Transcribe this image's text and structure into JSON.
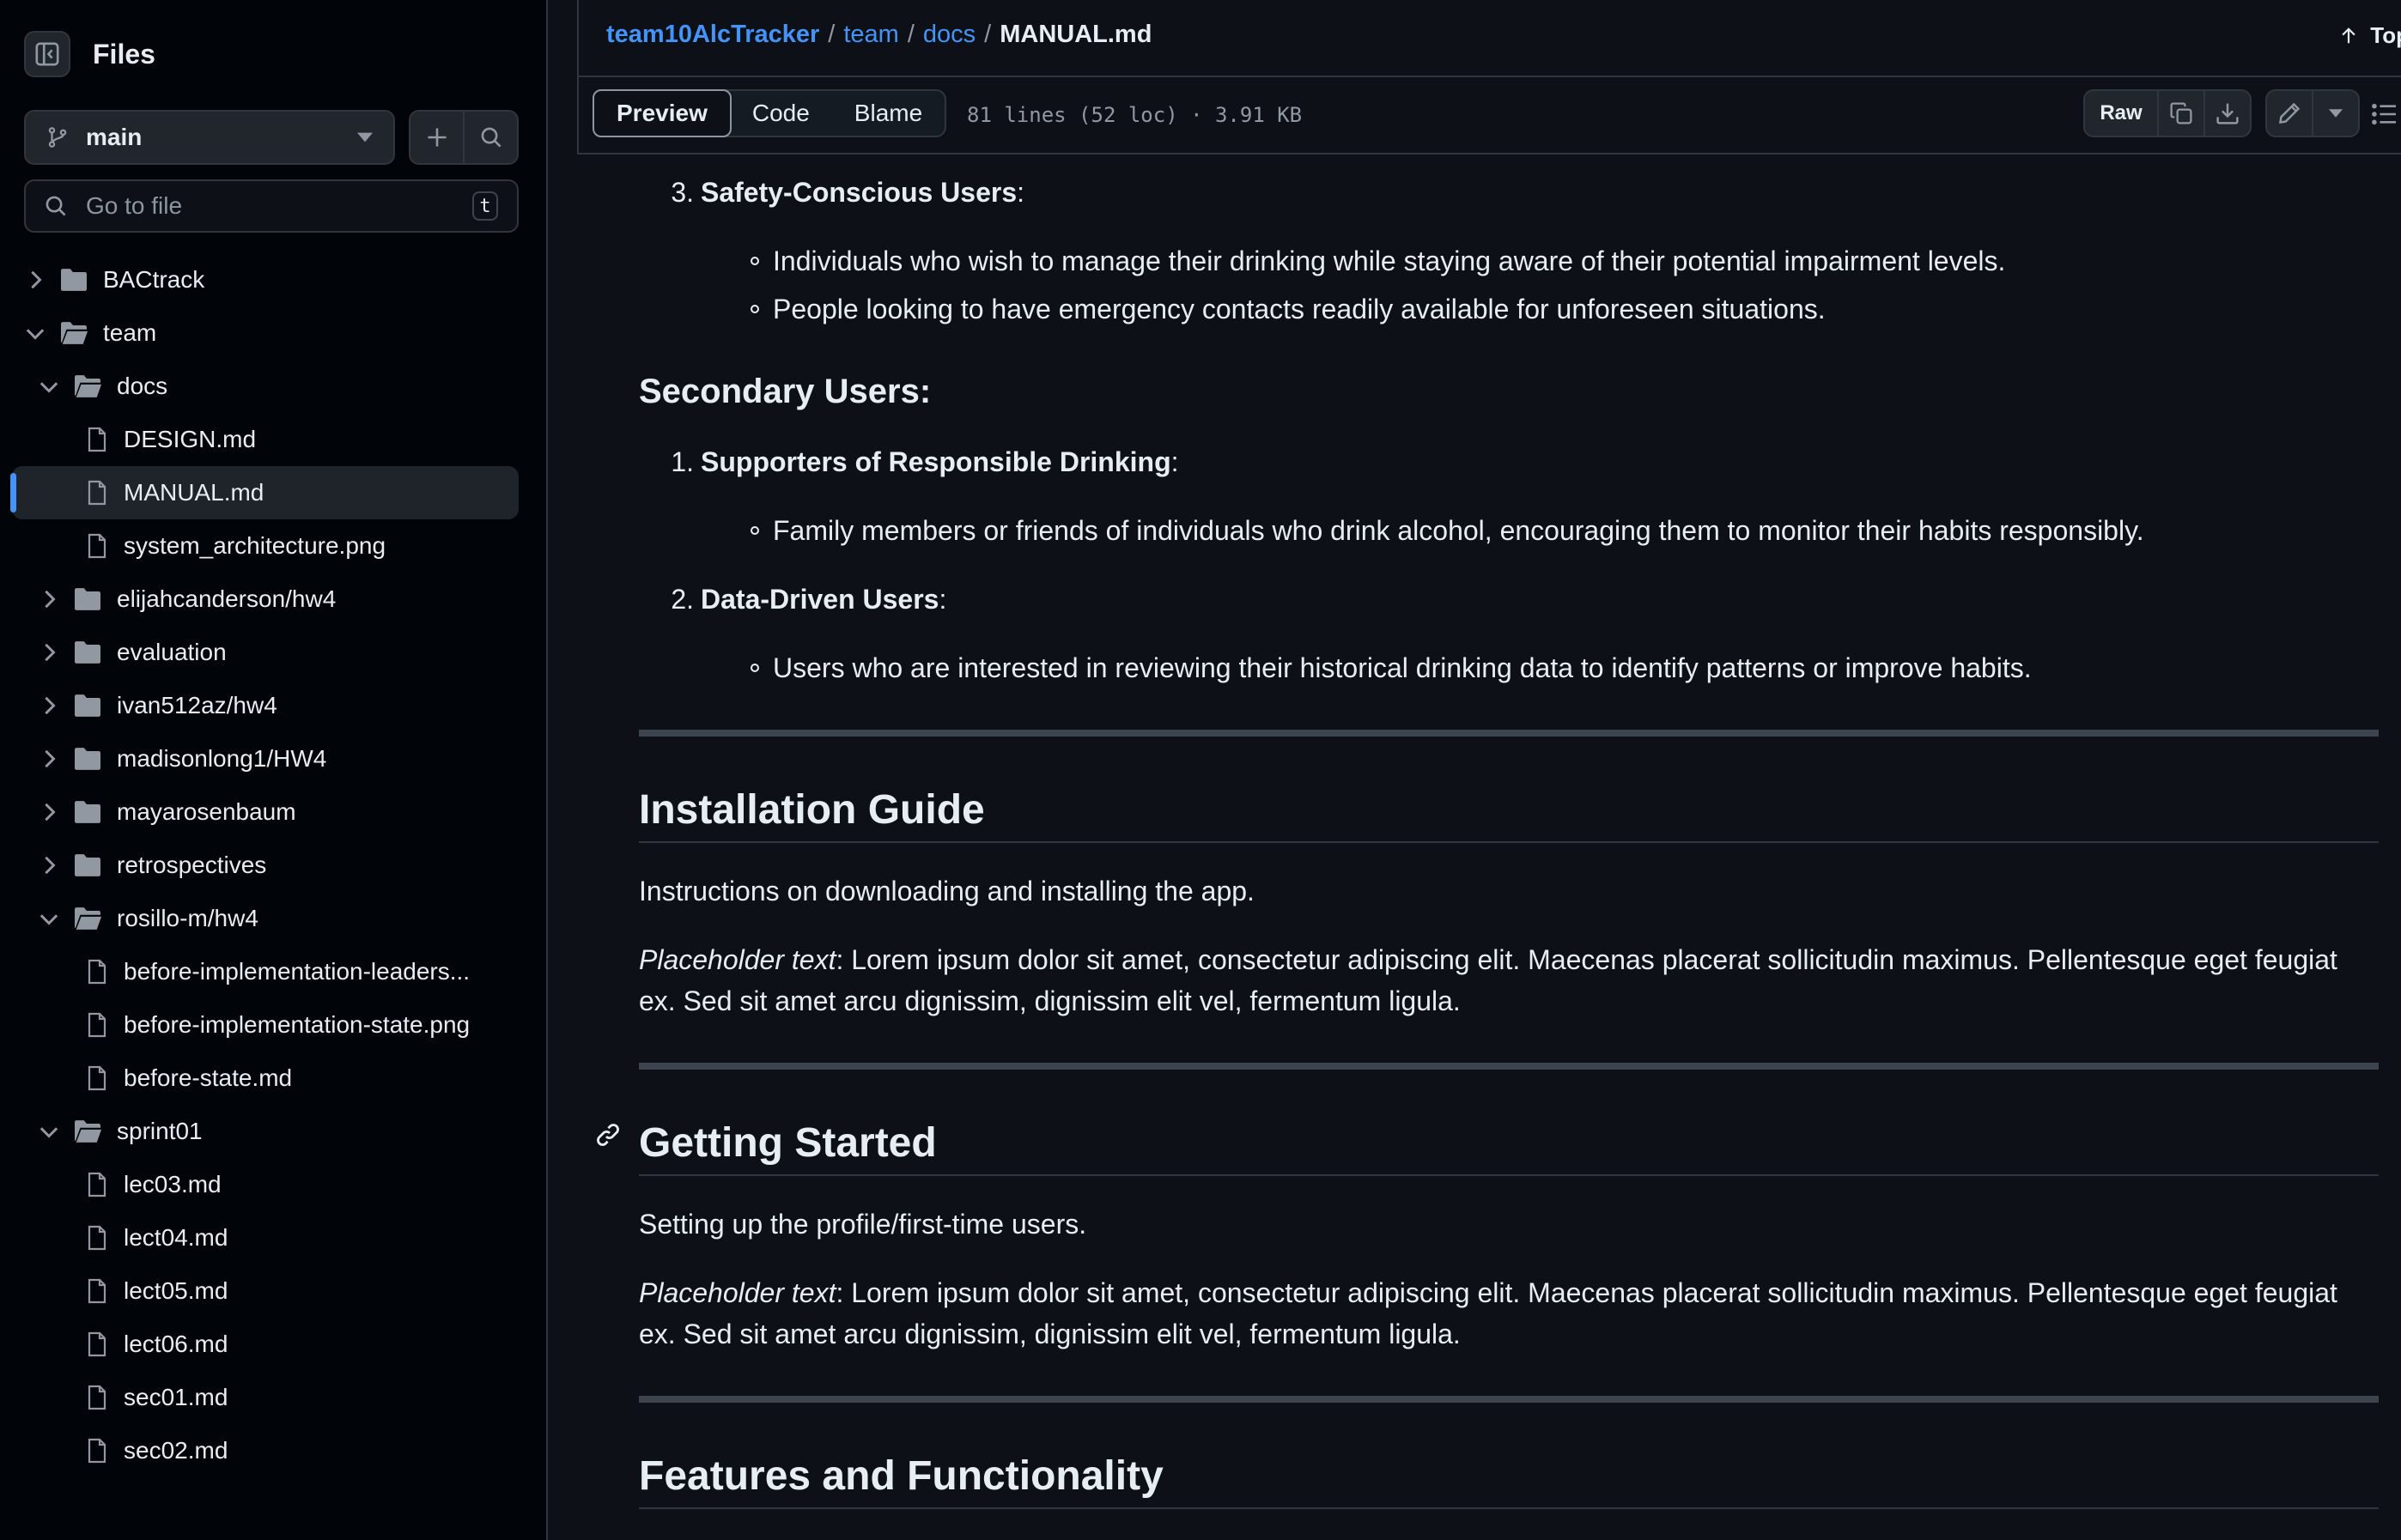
{
  "sidebar": {
    "title": "Files",
    "branch": "main",
    "goto_placeholder": "Go to file",
    "goto_shortcut": "t",
    "tree": [
      {
        "label": "BACtrack",
        "type": "folder",
        "expanded": false,
        "depth": 0
      },
      {
        "label": "team",
        "type": "folder",
        "expanded": true,
        "depth": 0
      },
      {
        "label": "docs",
        "type": "folder",
        "expanded": true,
        "depth": 1
      },
      {
        "label": "DESIGN.md",
        "type": "file",
        "depth": 2
      },
      {
        "label": "MANUAL.md",
        "type": "file",
        "depth": 2,
        "selected": true
      },
      {
        "label": "system_architecture.png",
        "type": "file",
        "depth": 2
      },
      {
        "label": "elijahcanderson/hw4",
        "type": "folder",
        "expanded": false,
        "depth": 1
      },
      {
        "label": "evaluation",
        "type": "folder",
        "expanded": false,
        "depth": 1
      },
      {
        "label": "ivan512az/hw4",
        "type": "folder",
        "expanded": false,
        "depth": 1
      },
      {
        "label": "madisonlong1/HW4",
        "type": "folder",
        "expanded": false,
        "depth": 1
      },
      {
        "label": "mayarosenbaum",
        "type": "folder",
        "expanded": false,
        "depth": 1
      },
      {
        "label": "retrospectives",
        "type": "folder",
        "expanded": false,
        "depth": 1
      },
      {
        "label": "rosillo-m/hw4",
        "type": "folder",
        "expanded": true,
        "depth": 1
      },
      {
        "label": "before-implementation-leaders...",
        "type": "file",
        "depth": 2
      },
      {
        "label": "before-implementation-state.png",
        "type": "file",
        "depth": 2
      },
      {
        "label": "before-state.md",
        "type": "file",
        "depth": 2
      },
      {
        "label": "sprint01",
        "type": "folder",
        "expanded": true,
        "depth": 1
      },
      {
        "label": "lec03.md",
        "type": "file",
        "depth": 2
      },
      {
        "label": "lect04.md",
        "type": "file",
        "depth": 2
      },
      {
        "label": "lect05.md",
        "type": "file",
        "depth": 2
      },
      {
        "label": "lect06.md",
        "type": "file",
        "depth": 2
      },
      {
        "label": "sec01.md",
        "type": "file",
        "depth": 2
      },
      {
        "label": "sec02.md",
        "type": "file",
        "depth": 2
      }
    ]
  },
  "breadcrumb": {
    "repo": "team10AlcTracker",
    "sep": "/",
    "folder1": "team",
    "folder2": "docs",
    "file": "MANUAL.md"
  },
  "top_link": "Top",
  "toolbar": {
    "tabs": [
      "Preview",
      "Code",
      "Blame"
    ],
    "active_tab": "Preview",
    "meta": "81 lines (52 loc) · 3.91 KB",
    "raw_label": "Raw"
  },
  "doc": {
    "item3_num": "3.",
    "item3_title": "Safety-Conscious Users",
    "item3_bullets": [
      "Individuals who wish to manage their drinking while staying aware of their potential impairment levels.",
      "People looking to have emergency contacts readily available for unforeseen situations."
    ],
    "secondary_heading": "Secondary Users:",
    "sec_item1_num": "1.",
    "sec_item1_title": "Supporters of Responsible Drinking",
    "sec_item1_bullet": "Family members or friends of individuals who drink alcohol, encouraging them to monitor their habits responsibly.",
    "sec_item2_num": "2.",
    "sec_item2_title": "Data-Driven Users",
    "sec_item2_bullet": "Users who are interested in reviewing their historical drinking data to identify patterns or improve habits.",
    "colon": ":",
    "install_heading": "Installation Guide",
    "install_intro": "Instructions on downloading and installing the app.",
    "placeholder_label": "Placeholder text",
    "placeholder_body_line1": ": Lorem ipsum dolor sit amet, consectetur adipiscing elit. Maecenas placerat sollicitudin maximus. Pellentesque eget feugiat",
    "placeholder_body_line2": "ex. Sed sit amet arcu dignissim, dignissim elit vel, fermentum ligula.",
    "getting_started_heading": "Getting Started",
    "getting_started_intro": "Setting up the profile/first-time users.",
    "features_heading": "Features and Functionality"
  },
  "colors": {
    "background": "#0d1117",
    "sidebar_bg": "#010409",
    "link": "#4493f8",
    "border": "#30363d",
    "text": "#e6edf3",
    "muted": "#9198a1"
  }
}
